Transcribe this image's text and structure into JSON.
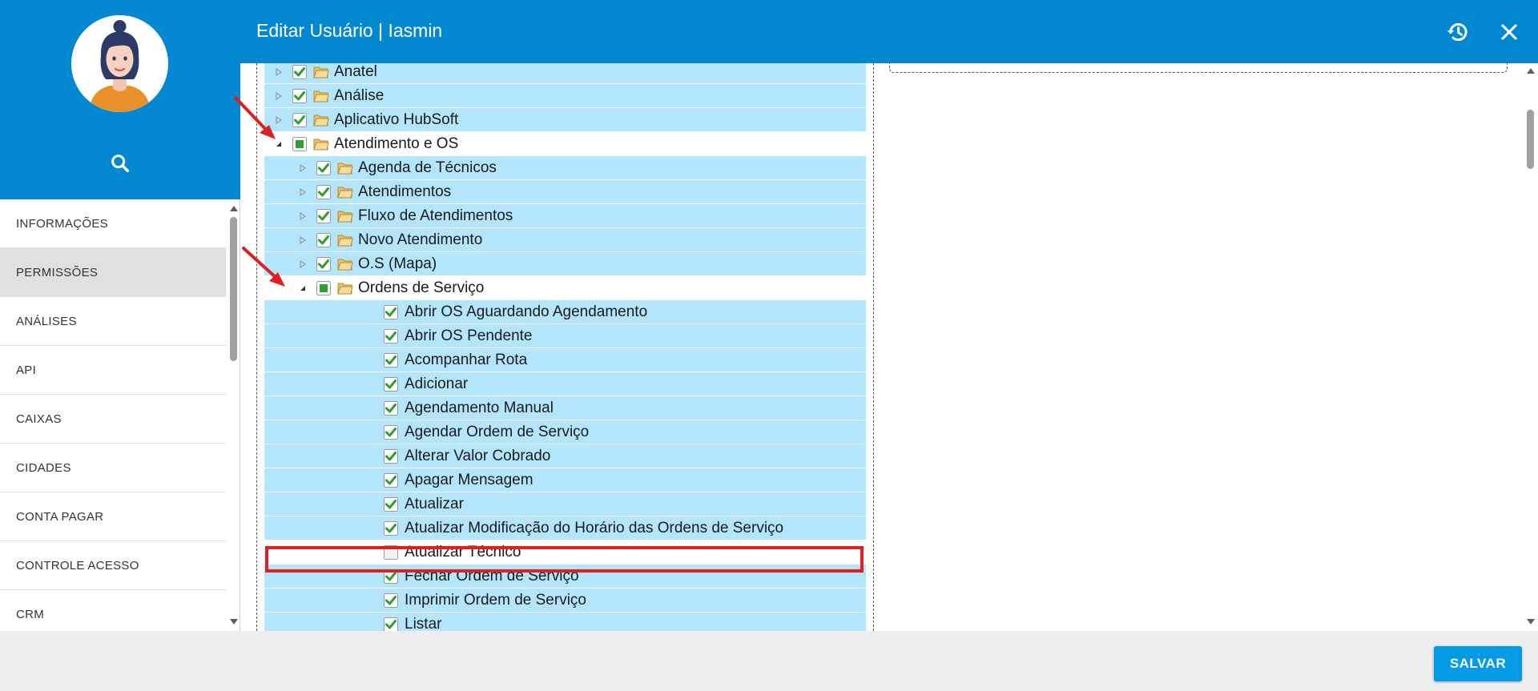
{
  "header": {
    "title": "Editar Usuário | Iasmin",
    "history_icon": "history-icon",
    "close_icon": "close-icon"
  },
  "sidebar": {
    "avatar_icon": "user-avatar",
    "search_icon": "search-icon",
    "items": [
      {
        "label": "INFORMAÇÕES",
        "active": false
      },
      {
        "label": "PERMISSÕES",
        "active": true
      },
      {
        "label": "ANÁLISES",
        "active": false
      },
      {
        "label": "API",
        "active": false
      },
      {
        "label": "CAIXAS",
        "active": false
      },
      {
        "label": "CIDADES",
        "active": false
      },
      {
        "label": "CONTA PAGAR",
        "active": false
      },
      {
        "label": "CONTROLE ACESSO",
        "active": false
      },
      {
        "label": "CRM",
        "active": false
      }
    ]
  },
  "tree": [
    {
      "label": "Anatel",
      "level": 0,
      "toggle": "collapsed",
      "check": "checked",
      "folder": true,
      "selected": true
    },
    {
      "label": "Análise",
      "level": 0,
      "toggle": "collapsed",
      "check": "checked",
      "folder": true,
      "selected": true
    },
    {
      "label": "Aplicativo HubSoft",
      "level": 0,
      "toggle": "collapsed",
      "check": "checked",
      "folder": true,
      "selected": true
    },
    {
      "label": "Atendimento e OS",
      "level": 0,
      "toggle": "expanded",
      "check": "partial",
      "folder": true,
      "selected": false
    },
    {
      "label": "Agenda de Técnicos",
      "level": 1,
      "toggle": "collapsed",
      "check": "checked",
      "folder": true,
      "selected": true
    },
    {
      "label": "Atendimentos",
      "level": 1,
      "toggle": "collapsed",
      "check": "checked",
      "folder": true,
      "selected": true
    },
    {
      "label": "Fluxo de Atendimentos",
      "level": 1,
      "toggle": "collapsed",
      "check": "checked",
      "folder": true,
      "selected": true
    },
    {
      "label": "Novo Atendimento",
      "level": 1,
      "toggle": "collapsed",
      "check": "checked",
      "folder": true,
      "selected": true
    },
    {
      "label": "O.S (Mapa)",
      "level": 1,
      "toggle": "collapsed",
      "check": "checked",
      "folder": true,
      "selected": true
    },
    {
      "label": "Ordens de Serviço",
      "level": 1,
      "toggle": "expanded",
      "check": "partial",
      "folder": true,
      "selected": false
    },
    {
      "label": "Abrir OS Aguardando Agendamento",
      "level": 2,
      "toggle": "none",
      "check": "checked",
      "folder": false,
      "selected": true
    },
    {
      "label": "Abrir OS Pendente",
      "level": 2,
      "toggle": "none",
      "check": "checked",
      "folder": false,
      "selected": true
    },
    {
      "label": "Acompanhar Rota",
      "level": 2,
      "toggle": "none",
      "check": "checked",
      "folder": false,
      "selected": true
    },
    {
      "label": "Adicionar",
      "level": 2,
      "toggle": "none",
      "check": "checked",
      "folder": false,
      "selected": true
    },
    {
      "label": "Agendamento Manual",
      "level": 2,
      "toggle": "none",
      "check": "checked",
      "folder": false,
      "selected": true
    },
    {
      "label": "Agendar Ordem de Serviço",
      "level": 2,
      "toggle": "none",
      "check": "checked",
      "folder": false,
      "selected": true
    },
    {
      "label": "Alterar Valor Cobrado",
      "level": 2,
      "toggle": "none",
      "check": "checked",
      "folder": false,
      "selected": true
    },
    {
      "label": "Apagar Mensagem",
      "level": 2,
      "toggle": "none",
      "check": "checked",
      "folder": false,
      "selected": true
    },
    {
      "label": "Atualizar",
      "level": 2,
      "toggle": "none",
      "check": "checked",
      "folder": false,
      "selected": true
    },
    {
      "label": "Atualizar Modificação do Horário das Ordens de Serviço",
      "level": 2,
      "toggle": "none",
      "check": "checked",
      "folder": false,
      "selected": true
    },
    {
      "label": "Atualizar Técnico",
      "level": 2,
      "toggle": "none",
      "check": "unchecked",
      "folder": false,
      "selected": false
    },
    {
      "label": "Fechar Ordem de Serviço",
      "level": 2,
      "toggle": "none",
      "check": "checked",
      "folder": false,
      "selected": true
    },
    {
      "label": "Imprimir Ordem de Serviço",
      "level": 2,
      "toggle": "none",
      "check": "checked",
      "folder": false,
      "selected": true
    },
    {
      "label": "Listar",
      "level": 2,
      "toggle": "none",
      "check": "checked",
      "folder": false,
      "selected": true
    }
  ],
  "footer": {
    "save_label": "SALVAR"
  },
  "colors": {
    "primary": "#0288d1",
    "selected_row": "#b3e5fc",
    "check_green": "#2e9e2e",
    "highlight_red": "#e02020",
    "save_button": "#039be5"
  }
}
